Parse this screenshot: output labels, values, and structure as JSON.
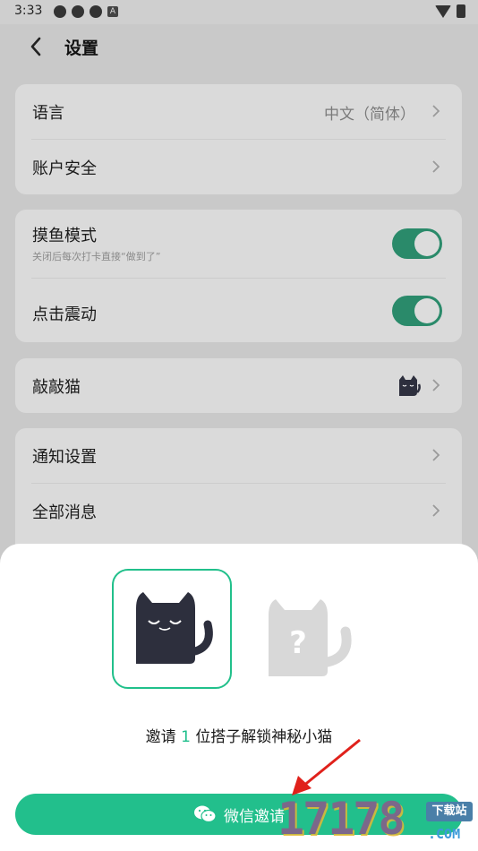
{
  "status_bar": {
    "time": "3:33",
    "notif_letter": "A"
  },
  "header": {
    "title": "设置"
  },
  "group1": [
    {
      "label": "语言",
      "value": "中文（简体）"
    },
    {
      "label": "账户安全"
    }
  ],
  "group2": [
    {
      "label": "摸鱼模式",
      "sublabel": "关闭后每次打卡直接“做到了”",
      "toggle_on": true
    },
    {
      "label": "点击震动",
      "toggle_on": true
    }
  ],
  "group3": [
    {
      "label": "敲敲猫"
    }
  ],
  "group4": [
    {
      "label": "通知设置"
    },
    {
      "label": "全部消息"
    }
  ],
  "sheet": {
    "invite_prefix": "邀请",
    "invite_count": "1",
    "invite_suffix": "位搭子解锁神秘小猫",
    "button_label": "微信邀请"
  },
  "watermark": {
    "text": "17178",
    "badge": "下载站",
    "domain": ".COM"
  },
  "colors": {
    "accent": "#22bf8c",
    "toggle": "#2a8a6a",
    "cat": "#2d2f3d"
  }
}
